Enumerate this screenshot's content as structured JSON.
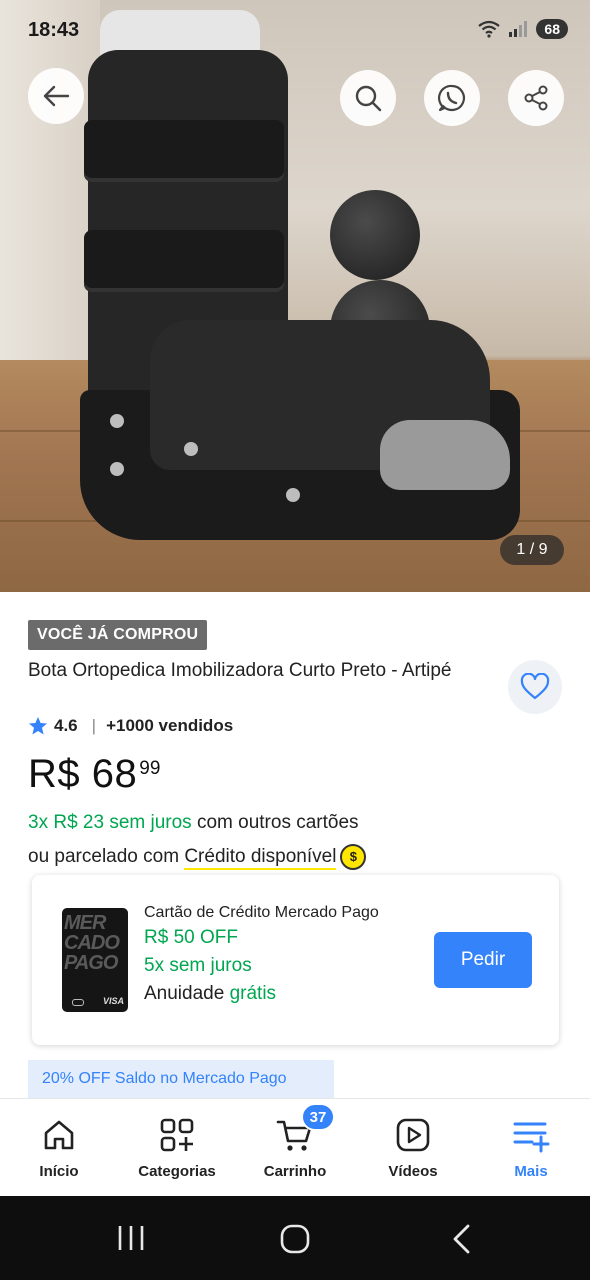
{
  "status_bar": {
    "time": "18:43",
    "battery": "68"
  },
  "gallery": {
    "counter": "1 / 9"
  },
  "product": {
    "badge": "VOCÊ JÁ COMPROU",
    "title": "Bota Ortopedica Imobilizadora Curto Preto - Artipé",
    "rating": "4.6",
    "rating_separator": "|",
    "sold": "+1000 vendidos",
    "price_main": "R$ 68",
    "price_cents": "99",
    "installments_green": "3x R$ 23 sem juros",
    "installments_rest": " com outros cartões",
    "credit_prefix": "ou parcelado com ",
    "credit_link": "Crédito disponível",
    "coin_symbol": "$"
  },
  "card_offer": {
    "title": "Cartão de Crédito Mercado Pago",
    "line1": "R$ 50 OFF",
    "line2": "5x sem juros",
    "line3_prefix": "Anuidade ",
    "line3_green": "grátis",
    "button": "Pedir",
    "card_lines": [
      "MER",
      "CADO",
      "PAGO"
    ],
    "card_brand": "VISA"
  },
  "promo": {
    "label": "20% OFF Saldo no Mercado Pago"
  },
  "bottom_nav": {
    "items": [
      {
        "label": "Início",
        "icon": "home-icon"
      },
      {
        "label": "Categorias",
        "icon": "categories-icon"
      },
      {
        "label": "Carrinho",
        "icon": "cart-icon",
        "badge": "37"
      },
      {
        "label": "Vídeos",
        "icon": "video-icon"
      },
      {
        "label": "Mais",
        "icon": "menu-plus-icon",
        "active": true
      }
    ]
  },
  "colors": {
    "accent_blue": "#3483fa",
    "green": "#00a650",
    "yellow": "#ffe600"
  }
}
